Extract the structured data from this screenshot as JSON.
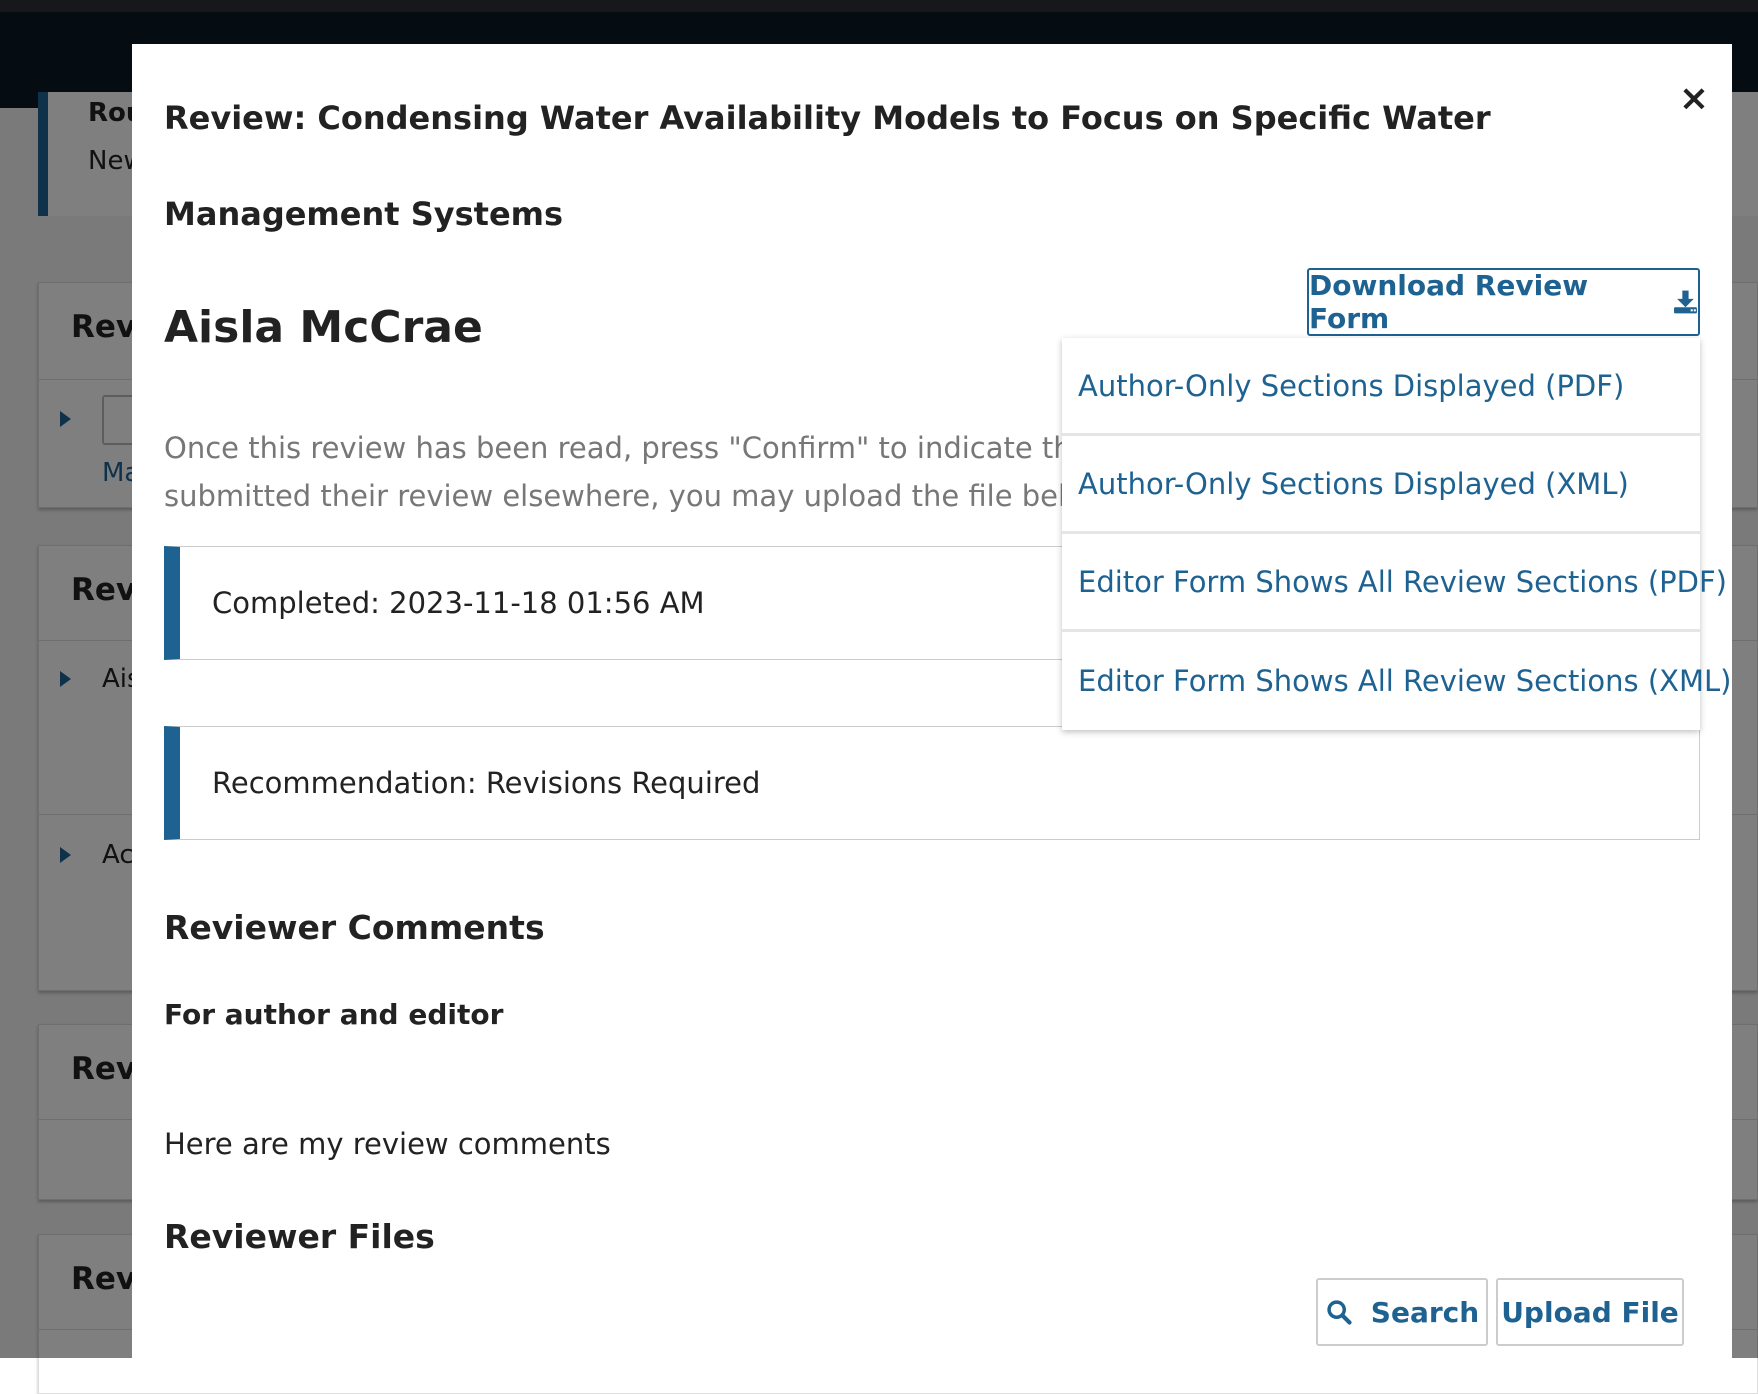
{
  "background": {
    "round_title": "Rou",
    "round_status": "New",
    "cards": [
      {
        "title": "Revi",
        "row_link": "Ma"
      },
      {
        "title": "Revi",
        "rows": [
          "Ais",
          "Ac"
        ]
      },
      {
        "title": "Revi"
      },
      {
        "title": "Revi"
      }
    ]
  },
  "modal": {
    "title": "Review: Condensing Water Availability Models to Focus on Specific Water Management Systems",
    "reviewer_name": "Aisla McCrae",
    "intro_line1": "Once this review has been read, press \"Confirm\" to indicate that the",
    "intro_line2": "submitted their review elsewhere, you may upload the file below and",
    "completed": "Completed: 2023-11-18 01:56 AM",
    "recommendation": "Recommendation: Revisions Required",
    "reviewer_comments_heading": "Reviewer Comments",
    "comment_audience": "For author and editor",
    "comment_text": "Here are my review comments",
    "reviewer_files_heading": "Reviewer Files",
    "download_button": "Download Review Form",
    "download_options": [
      "Author-Only Sections Displayed (PDF)",
      "Author-Only Sections Displayed (XML)",
      "Editor Form Shows All Review Sections (PDF)",
      "Editor Form Shows All Review Sections (XML)"
    ],
    "search_button": "Search",
    "upload_button": "Upload File",
    "close_symbol": "×"
  },
  "colors": {
    "accent": "#1e6292",
    "navbar": "#0b1a24",
    "text": "#222222",
    "muted_text": "#777777"
  }
}
